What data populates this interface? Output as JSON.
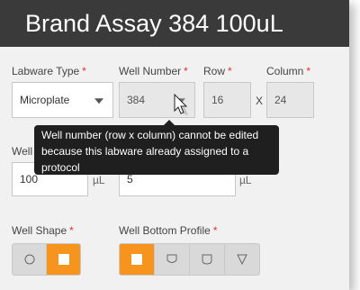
{
  "header": {
    "title": "Brand Assay 384 100uL"
  },
  "form": {
    "labware_type": {
      "label": "Labware Type",
      "required_mark": "*",
      "value": "Microplate"
    },
    "well_number": {
      "label": "Well Number",
      "required_mark": "*",
      "value": "384"
    },
    "row": {
      "label": "Row",
      "required_mark": "*",
      "value": "16"
    },
    "separator": "X",
    "column": {
      "label": "Column",
      "required_mark": "*",
      "value": "24"
    },
    "well_volume": {
      "label_partial": "Well",
      "value": "100",
      "unit": "µL"
    },
    "second_field": {
      "value": "5",
      "unit": "µL"
    },
    "well_shape": {
      "label": "Well Shape",
      "required_mark": "*",
      "options": [
        "circle",
        "square"
      ],
      "selected": "square"
    },
    "well_bottom_profile": {
      "label": "Well Bottom Profile",
      "required_mark": "*",
      "options": [
        "flat",
        "round",
        "u-shape",
        "v-shape"
      ],
      "selected": "flat"
    }
  },
  "tooltip": {
    "text": "Well number (row x column) cannot be edited because this labware already assigned to a protocol"
  },
  "colors": {
    "accent": "#f7941d",
    "header_bg": "#3a3a3a",
    "required": "#e4312f",
    "tooltip_bg": "#1f1f1f"
  }
}
